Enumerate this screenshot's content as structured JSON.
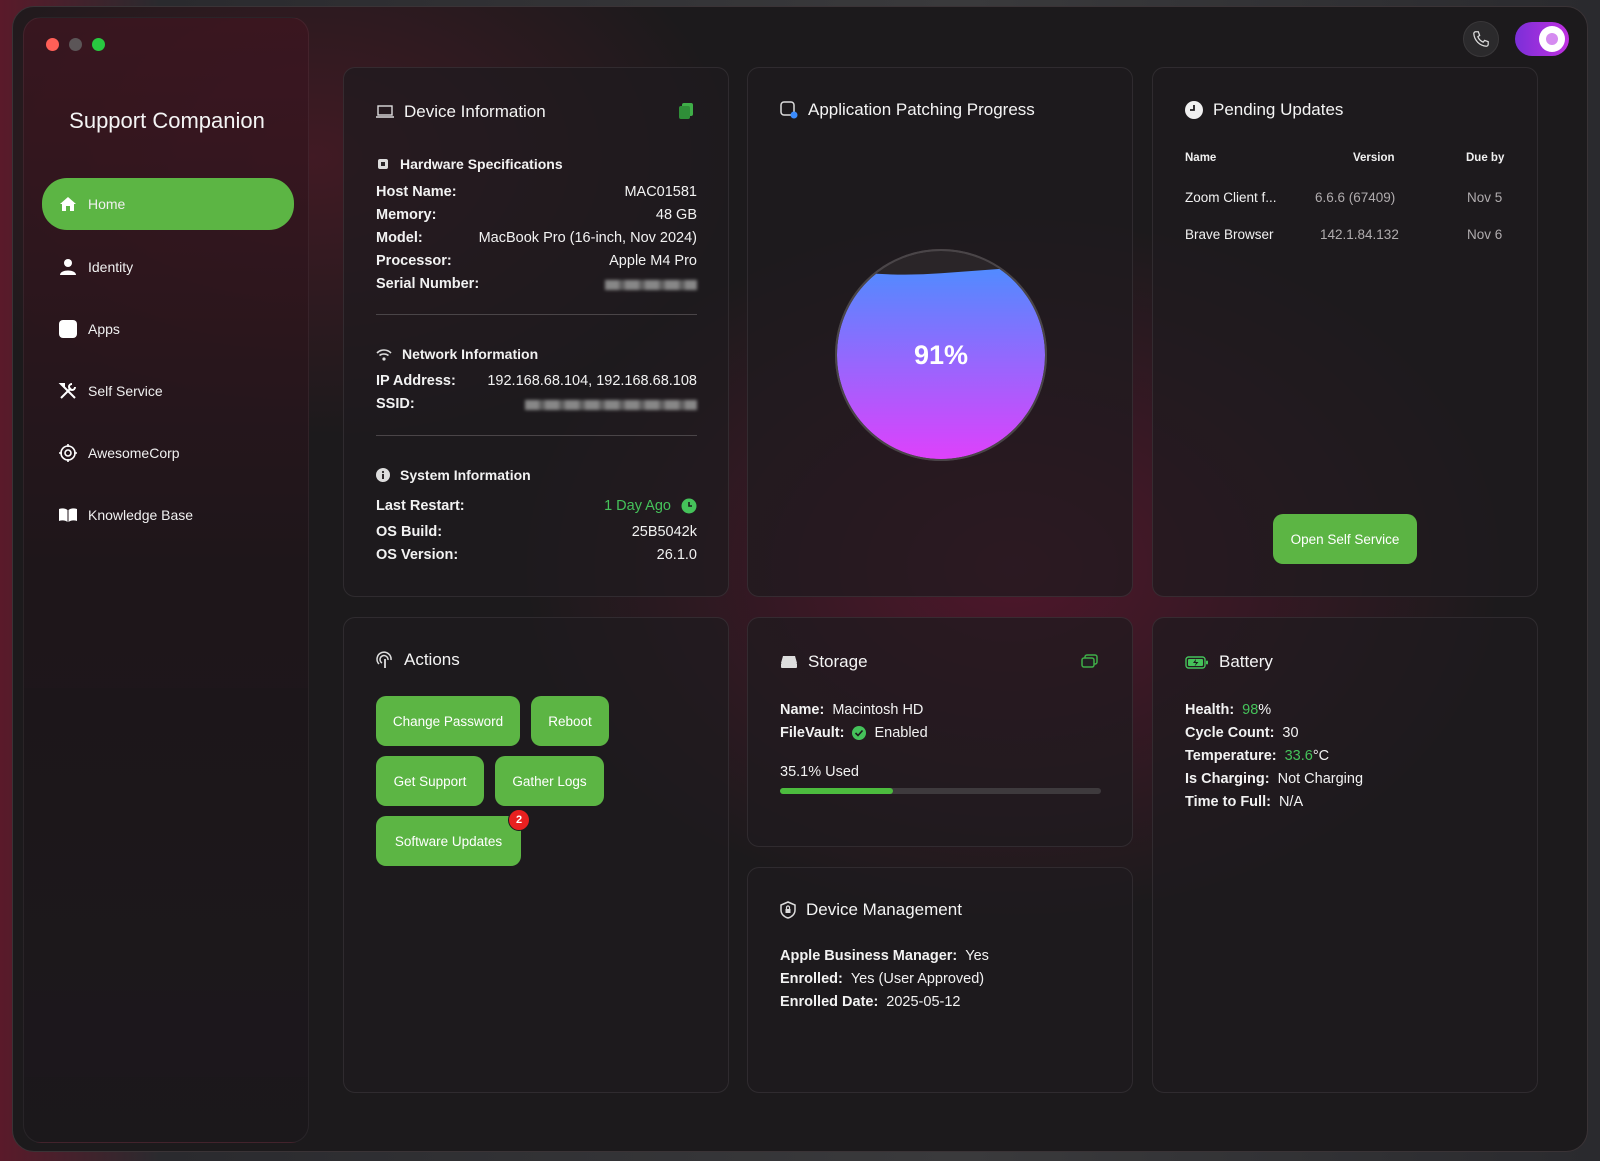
{
  "app": {
    "title": "Support Companion"
  },
  "sidebar": {
    "items": [
      {
        "label": "Home",
        "icon": "home-icon",
        "active": true
      },
      {
        "label": "Identity",
        "icon": "person-icon"
      },
      {
        "label": "Apps",
        "icon": "apps-icon"
      },
      {
        "label": "Self Service",
        "icon": "tools-icon"
      },
      {
        "label": "AwesomeCorp",
        "icon": "gear-icon"
      },
      {
        "label": "Knowledge Base",
        "icon": "book-icon"
      }
    ]
  },
  "device_info": {
    "title": "Device Information",
    "hardware": {
      "heading": "Hardware Specifications",
      "host_label": "Host Name:",
      "host": "MAC01581",
      "memory_label": "Memory:",
      "memory": "48 GB",
      "model_label": "Model:",
      "model": "MacBook Pro (16-inch, Nov 2024)",
      "processor_label": "Processor:",
      "processor": "Apple M4 Pro",
      "serial_label": "Serial Number:"
    },
    "network": {
      "heading": "Network Information",
      "ip_label": "IP Address:",
      "ip": "192.168.68.104, 192.168.68.108",
      "ssid_label": "SSID:"
    },
    "system": {
      "heading": "System Information",
      "restart_label": "Last Restart:",
      "restart": "1 Day Ago",
      "build_label": "OS Build:",
      "build": "25B5042k",
      "version_label": "OS Version:",
      "version": "26.1.0"
    }
  },
  "patching": {
    "title": "Application Patching Progress",
    "percent_label": "91%",
    "percent": 91
  },
  "pending_updates": {
    "title": "Pending Updates",
    "columns": [
      "Name",
      "Version",
      "Due by"
    ],
    "rows": [
      {
        "name": "Zoom Client f...",
        "version": "6.6.6 (67409)",
        "due": "Nov 5"
      },
      {
        "name": "Brave Browser",
        "version": "142.1.84.132",
        "due": "Nov 6"
      }
    ],
    "button": "Open Self Service"
  },
  "actions": {
    "title": "Actions",
    "buttons": [
      "Change Password",
      "Reboot",
      "Get Support",
      "Gather Logs",
      "Software Updates"
    ],
    "badge": "2"
  },
  "storage": {
    "title": "Storage",
    "name_label": "Name:",
    "name": "Macintosh HD",
    "filevault_label": "FileVault:",
    "filevault": "Enabled",
    "used_label": "35.1% Used",
    "used_percent": 35.1
  },
  "battery": {
    "title": "Battery",
    "health_label": "Health:",
    "health": "98",
    "health_unit": "%",
    "cycle_label": "Cycle Count:",
    "cycle": "30",
    "temp_label": "Temperature:",
    "temp": "33.6",
    "temp_unit": "°C",
    "charging_label": "Is Charging:",
    "charging": "Not Charging",
    "full_label": "Time to Full:",
    "full": "N/A"
  },
  "device_mgmt": {
    "title": "Device Management",
    "abm_label": "Apple Business Manager:",
    "abm": "Yes",
    "enrolled_label": "Enrolled:",
    "enrolled": "Yes (User Approved)",
    "date_label": "Enrolled Date:",
    "date": "2025-05-12"
  },
  "colors": {
    "accent": "#5cb544",
    "badge": "#e82020",
    "patch_top": "#4f8cff",
    "patch_bottom": "#e040fb"
  }
}
